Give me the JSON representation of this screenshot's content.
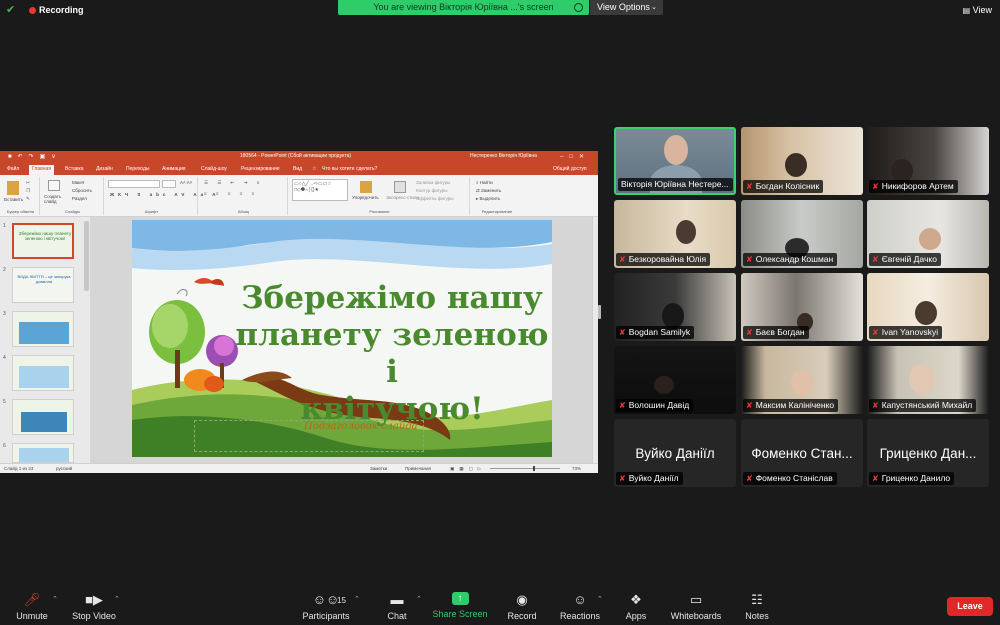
{
  "top_bar": {
    "recording_label": "Recording",
    "viewing_banner": "You are viewing Вікторія Юріївна ...'s screen",
    "view_options_label": "View Options",
    "view_button_label": "View"
  },
  "powerpoint": {
    "window_title": "180564 - PowerPoint (Сбой активации продукта)",
    "user_name": "Нестеренко Вікторія Юріївна",
    "tabs": [
      "Файл",
      "Главная",
      "Вставка",
      "Дизайн",
      "Переходы",
      "Анимация",
      "Слайд-шоу",
      "Рецензирование",
      "Вид"
    ],
    "tell_me": "Что вы хотите сделать?",
    "share_label": "Общий доступ",
    "ribbon_groups": [
      "Буфер обмена",
      "Слайды",
      "Шрифт",
      "Абзац",
      "Рисование",
      "Редактирование"
    ],
    "ribbon_buttons": {
      "paste": "Вставить",
      "new_slide": "Создать слайд",
      "layout": "Макет",
      "reset": "Сбросить",
      "section": "Раздел",
      "arrange": "Упорядочить",
      "quick_styles": "Экспресс-стили",
      "fill": "Заливка фигуры",
      "outline": "Контур фигуры",
      "effects": "Эффекты фигуры",
      "find": "Найти",
      "replace": "Заменить",
      "select": "Выделить"
    },
    "thumbnails": [
      {
        "num": "1",
        "text": "Збережімо нашу планету зеленою і квітучою!"
      },
      {
        "num": "2",
        "text": "ВОДА ЖИТТЯ – це запорука довкілля"
      },
      {
        "num": "3",
        "text": ""
      },
      {
        "num": "4",
        "text": ""
      },
      {
        "num": "5",
        "text": ""
      },
      {
        "num": "6",
        "text": ""
      }
    ],
    "slide": {
      "title_line1": "Збережімо нашу",
      "title_line2": "планету зеленою і",
      "title_line3": "квітучою!",
      "subtitle": "Подзаголовок слайда"
    },
    "status": {
      "slide_count": "Слайд 1 из 23",
      "language": "русский",
      "notes": "Заметки",
      "comments": "Примечания",
      "zoom": "73%"
    }
  },
  "participants": [
    {
      "name": "Вікторія Юріївна Нестере...",
      "muted": false,
      "video": true,
      "active": true
    },
    {
      "name": "Богдан Колісник",
      "muted": true,
      "video": true
    },
    {
      "name": "Никифоров Артем",
      "muted": true,
      "video": true
    },
    {
      "name": "Безкоровайна Юлія",
      "muted": true,
      "video": true
    },
    {
      "name": "Олександр Кошман",
      "muted": true,
      "video": true
    },
    {
      "name": "Євгеній Дачко",
      "muted": true,
      "video": true
    },
    {
      "name": "Bogdan Samilyk",
      "muted": true,
      "video": true
    },
    {
      "name": "Баєв Богдан",
      "muted": true,
      "video": true
    },
    {
      "name": "Ivan Yanovskyi",
      "muted": true,
      "video": true
    },
    {
      "name": "Волошин Давід",
      "muted": true,
      "video": true
    },
    {
      "name": "Максим Калініченко",
      "muted": true,
      "video": true
    },
    {
      "name": "Капустянський Михайл",
      "muted": true,
      "video": true
    },
    {
      "name": "Вуйко Даніїл",
      "muted": true,
      "video": false,
      "big": "Вуйко Даніїл"
    },
    {
      "name": "Фоменко Станіслав",
      "muted": true,
      "video": false,
      "big": "Фоменко Стан..."
    },
    {
      "name": "Гриценко Данило",
      "muted": true,
      "video": false,
      "big": "Гриценко Дан..."
    }
  ],
  "toolbar": {
    "unmute": "Unmute",
    "stop_video": "Stop Video",
    "participants": "Participants",
    "participant_count": "15",
    "chat": "Chat",
    "share_screen": "Share Screen",
    "record": "Record",
    "reactions": "Reactions",
    "apps": "Apps",
    "whiteboards": "Whiteboards",
    "notes": "Notes",
    "leave": "Leave"
  },
  "colors": {
    "banner_green": "#2fcc6a",
    "leave_red": "#e02828",
    "muted_red": "#e53935",
    "powerpoint_accent": "#c8472b",
    "slide_title_green": "#4a8a2e"
  }
}
